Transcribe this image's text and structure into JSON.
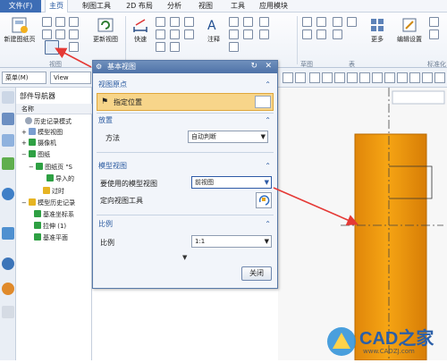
{
  "menu": {
    "file": "文件(F)",
    "tabs": [
      "主页",
      "制图工具",
      "2D 布局",
      "分析",
      "视图",
      "工具",
      "应用模块"
    ],
    "active_index": 0
  },
  "ribbon": {
    "new_sheet": "新建图纸页",
    "update_view": "更新视图",
    "quick": "快速",
    "annotation": "注释",
    "more": "更多",
    "edit_settings": "编辑设置",
    "group_view": "视图",
    "group_sketch": "草图",
    "group_table": "表",
    "group_standard": "标准化"
  },
  "toolbar2": {
    "menu_label": "菜单(M)",
    "view_select": "View"
  },
  "navigator": {
    "title": "部件导航器",
    "col_name": "名称",
    "items": [
      "历史记录模式",
      "模型视图",
      "摄像机",
      "图纸",
      "图纸页 \"S",
      "导入的",
      "过时",
      "模型历史记录",
      "基准坐标系",
      "拉伸 (1)",
      "基准平面"
    ]
  },
  "dialog": {
    "title": "基本视图",
    "section_origin": "视图原点",
    "specify_location": "指定位置",
    "section_placement": "放置",
    "method_label": "方法",
    "method_value": "自动判断",
    "section_model_view": "模型视图",
    "model_view_label": "要使用的模型视图",
    "model_view_value": "前视图",
    "orient_label": "定向视图工具",
    "section_scale": "比例",
    "scale_label": "比例",
    "scale_value": "1:1",
    "close_button": "关闭"
  },
  "colors": {
    "orange_body": "#f39a12",
    "highlight_row": "#f7d58a",
    "arrow_red": "#e53935",
    "dialog_title": "#4e72a8"
  },
  "watermark": "CAD之家",
  "watermark_url": "www.CADZJ.com"
}
